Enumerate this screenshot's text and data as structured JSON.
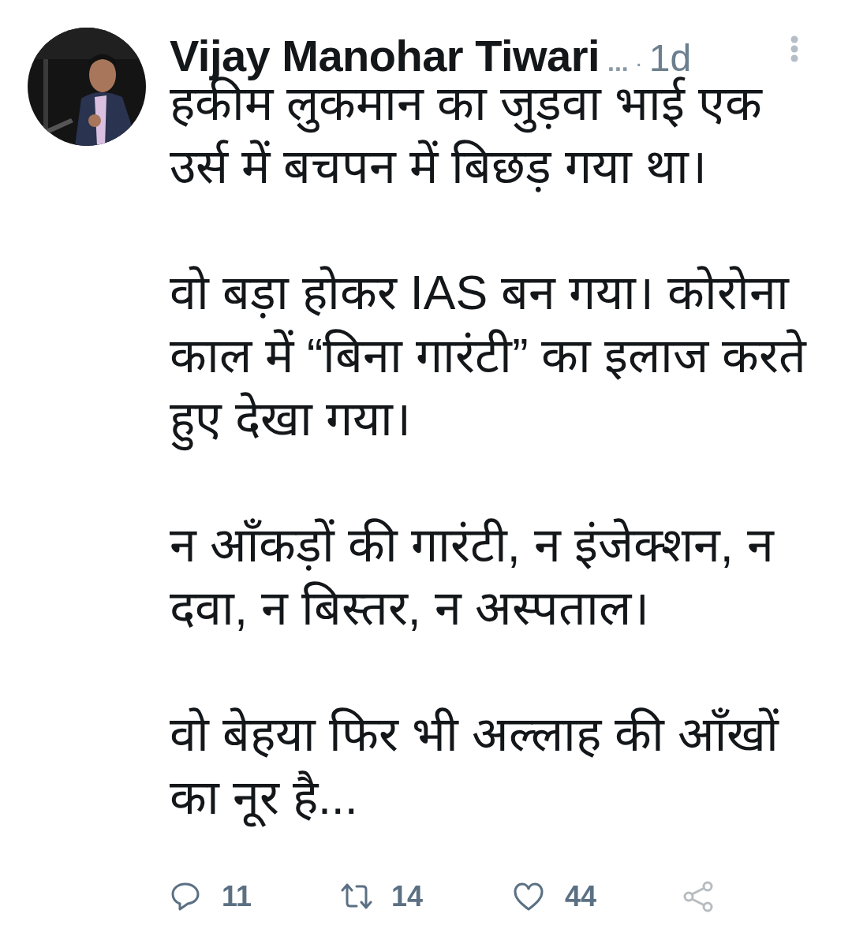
{
  "tweet": {
    "author": {
      "name": "Vijay Manohar Tiwari",
      "truncation": "...",
      "separator": "·",
      "time": "1d"
    },
    "paragraphs": [
      "हकीम लुकमान का जुड़वा भाई एक उर्स में बचपन में बिछड़ गया था।",
      "वो बड़ा होकर IAS बन गया। कोरोना काल में “बिना गारंटी” का इलाज करते हुए देखा गया।",
      "न आँकड़ों की गारंटी, न इंजेक्शन, न दवा, न बिस्तर, न अस्पताल।",
      "वो बेहया फिर भी अल्लाह की आँखों का नूर है..."
    ],
    "actions": [
      {
        "kind": "reply",
        "count": "11"
      },
      {
        "kind": "retweet",
        "count": "14"
      },
      {
        "kind": "like",
        "count": "44"
      },
      {
        "kind": "share"
      }
    ]
  }
}
